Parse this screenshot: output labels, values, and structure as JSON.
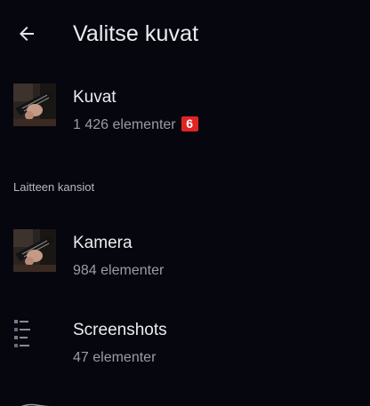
{
  "appbar": {
    "title": "Valitse kuvat",
    "back_icon": "arrow-back-icon"
  },
  "albums": [
    {
      "name": "Kuvat",
      "count": "1 426 elementer",
      "badge": "6",
      "thumb": "guitar-photo"
    }
  ],
  "section": {
    "header": "Laitteen kansiot"
  },
  "folders": [
    {
      "name": "Kamera",
      "count": "984 elementer",
      "thumb": "guitar-photo"
    },
    {
      "name": "Screenshots",
      "count": "47 elementer",
      "thumb": "screenshot-list"
    }
  ],
  "colors": {
    "background": "#06060e",
    "text_primary": "#ececf0",
    "text_secondary": "#9c9ca6",
    "badge": "#e02424"
  }
}
